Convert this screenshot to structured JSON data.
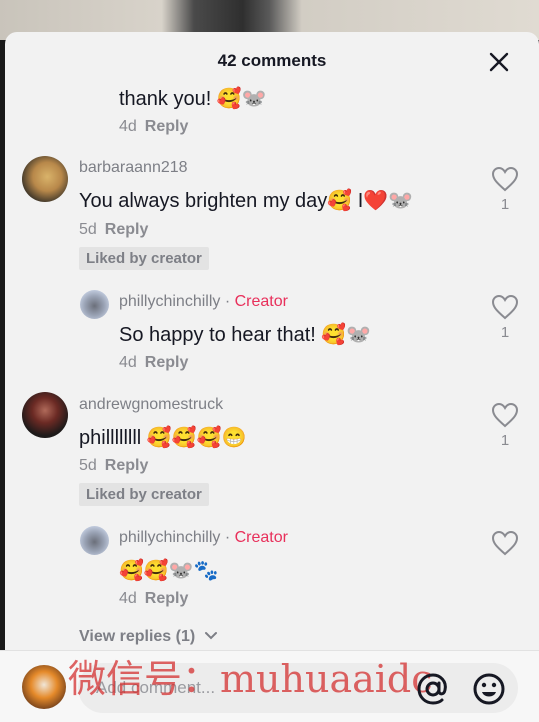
{
  "header": {
    "title": "42 comments"
  },
  "comments": [
    {
      "text": "thank you! 🥰🐭",
      "time": "4d",
      "reply_label": "Reply"
    },
    {
      "username": "barbaraann218",
      "text": "You always brighten my day🥰 I❤️🐭",
      "time": "5d",
      "reply_label": "Reply",
      "liked_badge": "Liked by creator",
      "like_count": "1"
    },
    {
      "username": "phillychinchilly",
      "creator_label": "Creator",
      "separator": "·",
      "text": "So happy to hear that! 🥰🐭",
      "time": "4d",
      "reply_label": "Reply",
      "like_count": "1"
    },
    {
      "username": "andrewgnomestruck",
      "text": "phillllllll 🥰🥰🥰😁",
      "time": "5d",
      "reply_label": "Reply",
      "liked_badge": "Liked by creator",
      "like_count": "1"
    },
    {
      "username": "phillychinchilly",
      "creator_label": "Creator",
      "separator": "·",
      "text": "🥰🥰🐭🐾",
      "time": "4d",
      "reply_label": "Reply"
    }
  ],
  "view_replies": "View replies (1)",
  "input": {
    "placeholder": "Add comment..."
  },
  "watermark": "微信号：muhuaaidc",
  "icons": {
    "close": "close-icon",
    "heart": "heart-icon",
    "mention": "at-icon",
    "emoji": "emoji-icon"
  },
  "colors": {
    "creator": "#e8305b",
    "sheet": "#f2f2f2"
  }
}
